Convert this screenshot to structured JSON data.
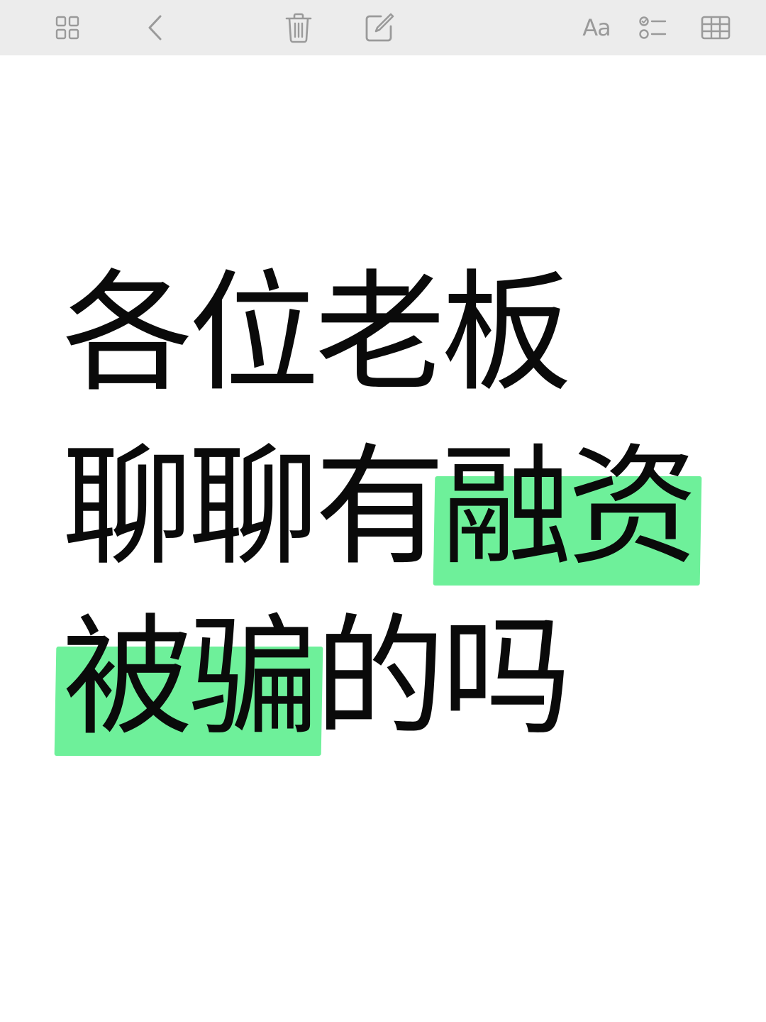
{
  "toolbar": {
    "icons": [
      "gallery-icon",
      "back-chevron-icon",
      "trash-icon",
      "compose-icon",
      "checklist-icon",
      "table-icon"
    ],
    "format_label": "Aa",
    "icon_color": "#9a9a9a",
    "background": "#ececec"
  },
  "note": {
    "lines": [
      {
        "text": "各位老板"
      },
      {
        "plain": "聊聊有",
        "highlight": "融资"
      },
      {
        "highlight": "被骗",
        "plain": "的吗"
      }
    ],
    "highlight_color": "#6ef09a",
    "text_color": "#0a0a0a"
  }
}
